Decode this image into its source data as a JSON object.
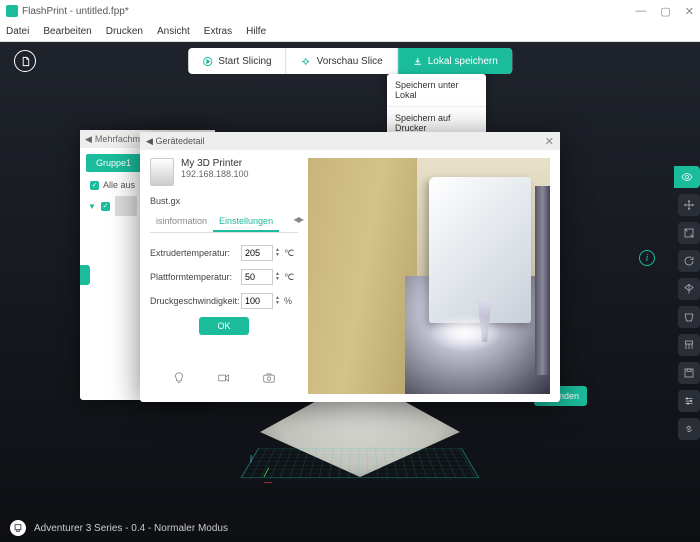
{
  "window": {
    "title": "FlashPrint - untitled.fpp*"
  },
  "menu": {
    "items": [
      "Datei",
      "Bearbeiten",
      "Drucken",
      "Ansicht",
      "Extras",
      "Hilfe"
    ]
  },
  "top_actions": {
    "start_slicing": "Start Slicing",
    "preview_slice": "Vorschau Slice",
    "save_local": "Lokal speichern"
  },
  "save_menu": {
    "items": [
      "Speichern unter Lokal",
      "Speichern auf Drucker"
    ]
  },
  "back_dialog": {
    "title_prefix": "Mehrfachmasch",
    "group_label": "Gruppe1",
    "select_all": "Alle aus"
  },
  "send_button": "e senden",
  "device_dialog": {
    "title": "Gerätedetail",
    "printer_name": "My 3D Printer",
    "printer_ip": "192.168.188.100",
    "file_name": "Bust.gx",
    "tabs": {
      "info": "isinformation",
      "settings": "Einstellungen"
    },
    "settings": {
      "extruder_label": "Extrudertemperatur:",
      "extruder_value": "205",
      "extruder_unit": "℃",
      "platform_label": "Plattformtemperatur:",
      "platform_value": "50",
      "platform_unit": "℃",
      "speed_label": "Druckgeschwindigkeit:",
      "speed_value": "100",
      "speed_unit": "%"
    },
    "ok": "OK"
  },
  "statusbar": {
    "text": "Adventurer 3 Series - 0.4 - Normaler Modus"
  },
  "right_tools": [
    "view",
    "move",
    "scale",
    "rotate",
    "mirror",
    "cut",
    "support",
    "save",
    "settings",
    "link"
  ]
}
